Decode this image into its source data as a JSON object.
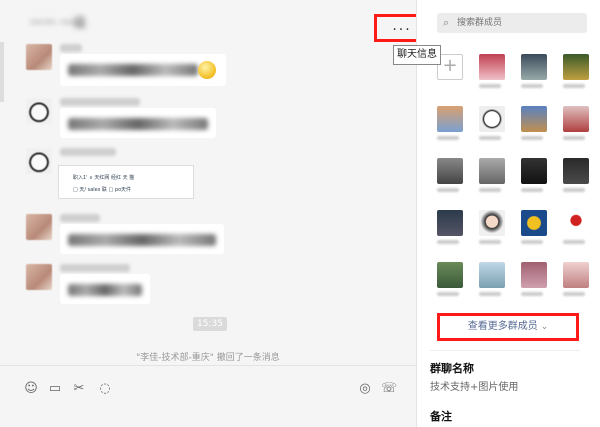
{
  "window": {
    "title": "一一 一级",
    "controls": {
      "pin": "⚲",
      "minimize": "—",
      "maximize": "▢",
      "close": "✕"
    }
  },
  "chat": {
    "more_label": "...",
    "tooltip": "聊天信息",
    "timestamp": "15:35",
    "recall_notice": "\"李佳-技术部-重庆\" 撤回了一条消息",
    "screenshot_snippet": {
      "row1": "职入1' ∨   天红网    经红   天 猫",
      "row2": "□ 天/ sales  联   □ po天件"
    }
  },
  "toolbar": {
    "emoji_icon": "☺",
    "folder_icon": "▭",
    "scissors_icon": "✂",
    "chat_icon": "◌",
    "call_icon": "◎",
    "phone_icon": "☏"
  },
  "panel": {
    "search_placeholder": "搜索群成员",
    "add_label": "+",
    "see_more": "查看更多群成员",
    "see_more_chevron": "⌄",
    "group_name_title": "群聊名称",
    "group_name_value": "技术支持+图片使用",
    "remark_title": "备注"
  },
  "colors": {
    "highlight": "#ff1a1a",
    "link": "#576b95",
    "panel_bg": "#ffffff",
    "chat_bg": "#f5f5f5"
  }
}
